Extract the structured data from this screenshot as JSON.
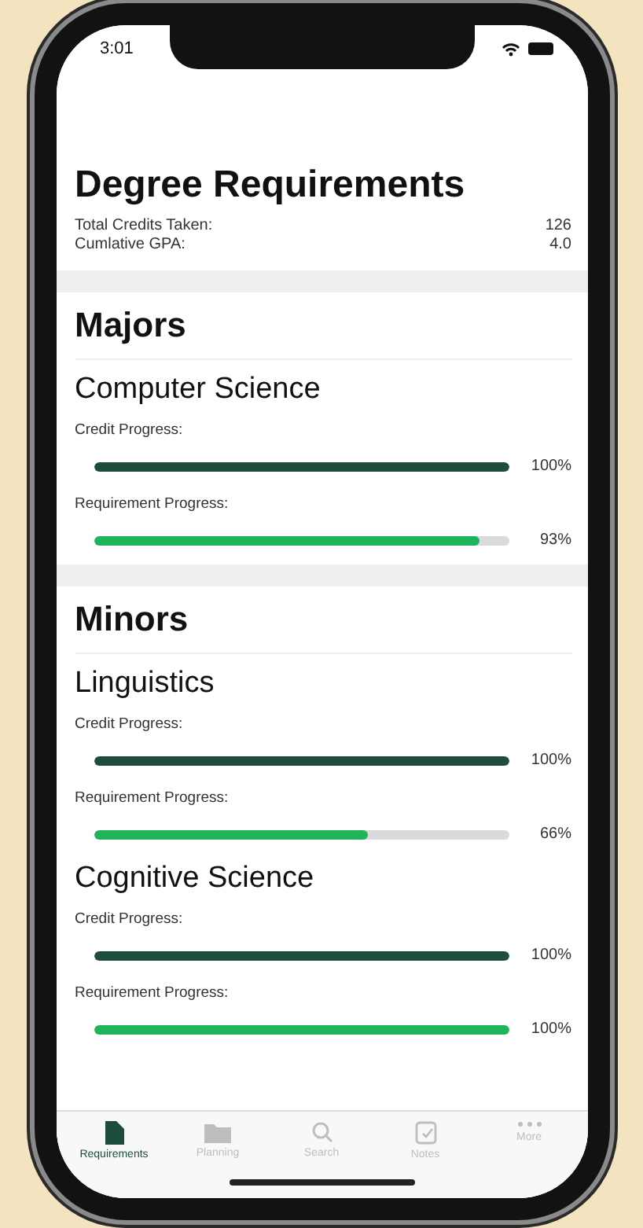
{
  "status_bar": {
    "time": "3:01"
  },
  "header": {
    "title": "Degree Requirements",
    "stats": [
      {
        "label": "Total Credits Taken:",
        "value": "126"
      },
      {
        "label": "Cumlative GPA:",
        "value": "4.0"
      }
    ]
  },
  "sections": [
    {
      "title": "Majors",
      "programs": [
        {
          "name": "Computer Science",
          "progress": [
            {
              "kind": "credit",
              "label": "Credit Progress:",
              "level": 1,
              "reading": "100%"
            },
            {
              "kind": "requirement",
              "label": "Requirement Progress:",
              "level": 0.93,
              "reading": "93%"
            }
          ]
        }
      ]
    },
    {
      "title": "Minors",
      "programs": [
        {
          "name": "Linguistics",
          "progress": [
            {
              "kind": "credit",
              "label": "Credit Progress:",
              "level": 1,
              "reading": "100%"
            },
            {
              "kind": "requirement",
              "label": "Requirement Progress:",
              "level": 0.66,
              "reading": "66%"
            }
          ]
        },
        {
          "name": "Cognitive Science",
          "progress": [
            {
              "kind": "credit",
              "label": "Credit Progress:",
              "level": 1,
              "reading": "100%"
            },
            {
              "kind": "requirement",
              "label": "Requirement Progress:",
              "level": 1,
              "reading": "100%"
            }
          ]
        }
      ]
    }
  ],
  "tab_bar": [
    {
      "kind": "document",
      "label": "Requirements",
      "selected": true
    },
    {
      "kind": "folder",
      "label": "Planning",
      "selected": false
    },
    {
      "kind": "search",
      "label": "Search",
      "selected": false
    },
    {
      "kind": "note",
      "label": "Notes",
      "selected": false
    },
    {
      "kind": "more",
      "label": "More",
      "selected": false
    }
  ]
}
